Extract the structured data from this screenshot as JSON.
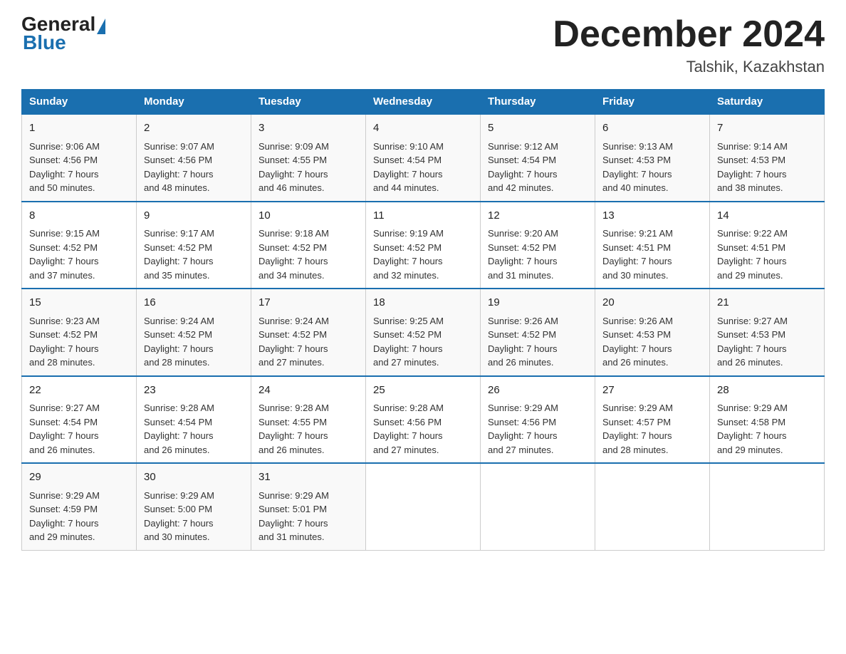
{
  "header": {
    "logo_general": "General",
    "logo_blue": "Blue",
    "month_year": "December 2024",
    "location": "Talshik, Kazakhstan"
  },
  "days_of_week": [
    "Sunday",
    "Monday",
    "Tuesday",
    "Wednesday",
    "Thursday",
    "Friday",
    "Saturday"
  ],
  "weeks": [
    [
      {
        "day": "1",
        "sunrise": "9:06 AM",
        "sunset": "4:56 PM",
        "daylight": "7 hours and 50 minutes."
      },
      {
        "day": "2",
        "sunrise": "9:07 AM",
        "sunset": "4:56 PM",
        "daylight": "7 hours and 48 minutes."
      },
      {
        "day": "3",
        "sunrise": "9:09 AM",
        "sunset": "4:55 PM",
        "daylight": "7 hours and 46 minutes."
      },
      {
        "day": "4",
        "sunrise": "9:10 AM",
        "sunset": "4:54 PM",
        "daylight": "7 hours and 44 minutes."
      },
      {
        "day": "5",
        "sunrise": "9:12 AM",
        "sunset": "4:54 PM",
        "daylight": "7 hours and 42 minutes."
      },
      {
        "day": "6",
        "sunrise": "9:13 AM",
        "sunset": "4:53 PM",
        "daylight": "7 hours and 40 minutes."
      },
      {
        "day": "7",
        "sunrise": "9:14 AM",
        "sunset": "4:53 PM",
        "daylight": "7 hours and 38 minutes."
      }
    ],
    [
      {
        "day": "8",
        "sunrise": "9:15 AM",
        "sunset": "4:52 PM",
        "daylight": "7 hours and 37 minutes."
      },
      {
        "day": "9",
        "sunrise": "9:17 AM",
        "sunset": "4:52 PM",
        "daylight": "7 hours and 35 minutes."
      },
      {
        "day": "10",
        "sunrise": "9:18 AM",
        "sunset": "4:52 PM",
        "daylight": "7 hours and 34 minutes."
      },
      {
        "day": "11",
        "sunrise": "9:19 AM",
        "sunset": "4:52 PM",
        "daylight": "7 hours and 32 minutes."
      },
      {
        "day": "12",
        "sunrise": "9:20 AM",
        "sunset": "4:52 PM",
        "daylight": "7 hours and 31 minutes."
      },
      {
        "day": "13",
        "sunrise": "9:21 AM",
        "sunset": "4:51 PM",
        "daylight": "7 hours and 30 minutes."
      },
      {
        "day": "14",
        "sunrise": "9:22 AM",
        "sunset": "4:51 PM",
        "daylight": "7 hours and 29 minutes."
      }
    ],
    [
      {
        "day": "15",
        "sunrise": "9:23 AM",
        "sunset": "4:52 PM",
        "daylight": "7 hours and 28 minutes."
      },
      {
        "day": "16",
        "sunrise": "9:24 AM",
        "sunset": "4:52 PM",
        "daylight": "7 hours and 28 minutes."
      },
      {
        "day": "17",
        "sunrise": "9:24 AM",
        "sunset": "4:52 PM",
        "daylight": "7 hours and 27 minutes."
      },
      {
        "day": "18",
        "sunrise": "9:25 AM",
        "sunset": "4:52 PM",
        "daylight": "7 hours and 27 minutes."
      },
      {
        "day": "19",
        "sunrise": "9:26 AM",
        "sunset": "4:52 PM",
        "daylight": "7 hours and 26 minutes."
      },
      {
        "day": "20",
        "sunrise": "9:26 AM",
        "sunset": "4:53 PM",
        "daylight": "7 hours and 26 minutes."
      },
      {
        "day": "21",
        "sunrise": "9:27 AM",
        "sunset": "4:53 PM",
        "daylight": "7 hours and 26 minutes."
      }
    ],
    [
      {
        "day": "22",
        "sunrise": "9:27 AM",
        "sunset": "4:54 PM",
        "daylight": "7 hours and 26 minutes."
      },
      {
        "day": "23",
        "sunrise": "9:28 AM",
        "sunset": "4:54 PM",
        "daylight": "7 hours and 26 minutes."
      },
      {
        "day": "24",
        "sunrise": "9:28 AM",
        "sunset": "4:55 PM",
        "daylight": "7 hours and 26 minutes."
      },
      {
        "day": "25",
        "sunrise": "9:28 AM",
        "sunset": "4:56 PM",
        "daylight": "7 hours and 27 minutes."
      },
      {
        "day": "26",
        "sunrise": "9:29 AM",
        "sunset": "4:56 PM",
        "daylight": "7 hours and 27 minutes."
      },
      {
        "day": "27",
        "sunrise": "9:29 AM",
        "sunset": "4:57 PM",
        "daylight": "7 hours and 28 minutes."
      },
      {
        "day": "28",
        "sunrise": "9:29 AM",
        "sunset": "4:58 PM",
        "daylight": "7 hours and 29 minutes."
      }
    ],
    [
      {
        "day": "29",
        "sunrise": "9:29 AM",
        "sunset": "4:59 PM",
        "daylight": "7 hours and 29 minutes."
      },
      {
        "day": "30",
        "sunrise": "9:29 AM",
        "sunset": "5:00 PM",
        "daylight": "7 hours and 30 minutes."
      },
      {
        "day": "31",
        "sunrise": "9:29 AM",
        "sunset": "5:01 PM",
        "daylight": "7 hours and 31 minutes."
      },
      null,
      null,
      null,
      null
    ]
  ],
  "sunrise_label": "Sunrise:",
  "sunset_label": "Sunset:",
  "daylight_label": "Daylight:"
}
